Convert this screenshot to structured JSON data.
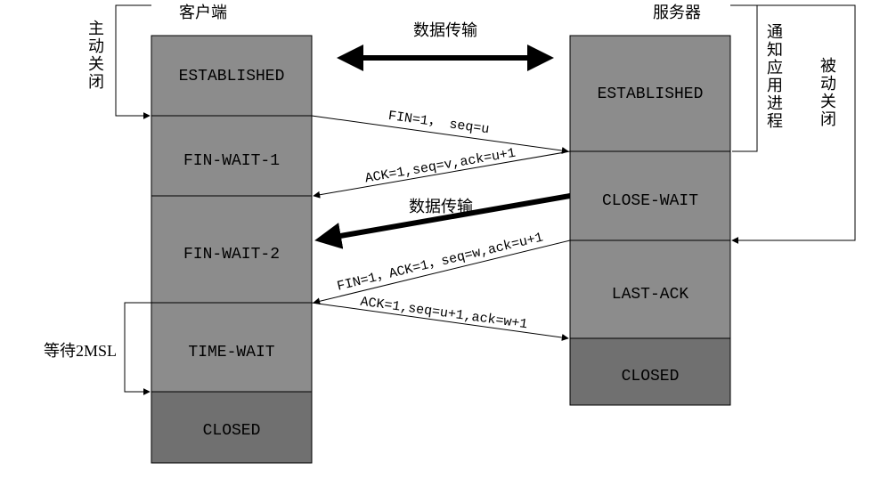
{
  "header": {
    "client_label": "客户端",
    "server_label": "服务器",
    "transfer_top": "数据传输",
    "transfer_mid": "数据传输"
  },
  "client": {
    "active_close_label": "主动关闭",
    "wait_label": "等待2MSL",
    "states": [
      "ESTABLISHED",
      "FIN-WAIT-1",
      "FIN-WAIT-2",
      "TIME-WAIT",
      "CLOSED"
    ]
  },
  "server": {
    "notify_label": "通知应用进程",
    "passive_close_label": "被动关闭",
    "states": [
      "ESTABLISHED",
      "CLOSE-WAIT",
      "LAST-ACK",
      "CLOSED"
    ]
  },
  "messages": {
    "fin1": "FIN=1， seq=u",
    "ack1": "ACK=1,seq=v,ack=u+1",
    "fin2": "FIN=1，ACK=1，seq=w,ack=u+1",
    "ack2": "ACK=1,seq=u+1,ack=w+1"
  }
}
